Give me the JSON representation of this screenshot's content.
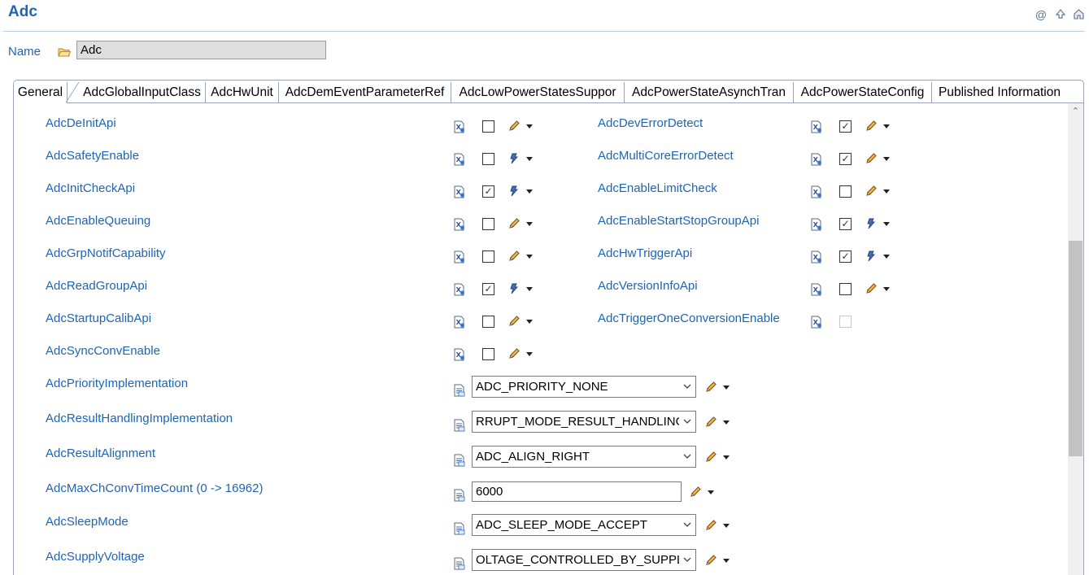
{
  "header": {
    "title": "Adc",
    "icons": [
      "at-icon",
      "up-arrow-icon",
      "home-icon"
    ]
  },
  "name_field": {
    "label": "Name",
    "value": "Adc"
  },
  "tabs": [
    {
      "label": "General",
      "active": true
    },
    {
      "label": "AdcGlobalInputClass"
    },
    {
      "label": "AdcHwUnit"
    },
    {
      "label": "AdcDemEventParameterRef"
    },
    {
      "label": "AdcLowPowerStatesSuppor"
    },
    {
      "label": "AdcPowerStateAsynchTran"
    },
    {
      "label": "AdcPowerStateConfig"
    },
    {
      "label": "Published Information"
    }
  ],
  "left_params": [
    {
      "label": "AdcDeInitApi",
      "checked": false,
      "mode": "pencil"
    },
    {
      "label": "AdcSafetyEnable",
      "checked": false,
      "mode": "gear"
    },
    {
      "label": "AdcInitCheckApi",
      "checked": true,
      "mode": "gear"
    },
    {
      "label": "AdcEnableQueuing",
      "checked": false,
      "mode": "pencil"
    },
    {
      "label": "AdcGrpNotifCapability",
      "checked": false,
      "mode": "pencil"
    },
    {
      "label": "AdcReadGroupApi",
      "checked": true,
      "mode": "gear"
    },
    {
      "label": "AdcStartupCalibApi",
      "checked": false,
      "mode": "pencil"
    },
    {
      "label": "AdcSyncConvEnable",
      "checked": false,
      "mode": "pencil"
    }
  ],
  "right_params": [
    {
      "label": "AdcDevErrorDetect",
      "checked": true,
      "mode": "pencil"
    },
    {
      "label": "AdcMultiCoreErrorDetect",
      "checked": true,
      "mode": "pencil"
    },
    {
      "label": "AdcEnableLimitCheck",
      "checked": false,
      "mode": "pencil"
    },
    {
      "label": "AdcEnableStartStopGroupApi",
      "checked": true,
      "mode": "gear"
    },
    {
      "label": "AdcHwTriggerApi",
      "checked": true,
      "mode": "gear"
    },
    {
      "label": "AdcVersionInfoApi",
      "checked": false,
      "mode": "pencil"
    },
    {
      "label": "AdcTriggerOneConversionEnable",
      "checked": false,
      "disabled": true,
      "mode": "none"
    }
  ],
  "value_params": [
    {
      "label": "AdcPriorityImplementation",
      "type": "combo",
      "value": "ADC_PRIORITY_NONE"
    },
    {
      "label": "AdcResultHandlingImplementation",
      "type": "combo",
      "value": "RRUPT_MODE_RESULT_HANDLING"
    },
    {
      "label": "AdcResultAlignment",
      "type": "combo",
      "value": "ADC_ALIGN_RIGHT"
    },
    {
      "label": "AdcMaxChConvTimeCount (0 -> 16962)",
      "type": "text",
      "value": "6000"
    },
    {
      "label": "AdcSleepMode",
      "type": "combo",
      "value": "ADC_SLEEP_MODE_ACCEPT"
    },
    {
      "label": "AdcSupplyVoltage",
      "type": "combo",
      "value": "OLTAGE_CONTROLLED_BY_SUPPLY"
    }
  ],
  "colors": {
    "label_blue": "#1e64b4",
    "border": "#9aa6b6",
    "pencil_orange": "#e08a1e",
    "gear_blue": "#2c4c8c"
  }
}
